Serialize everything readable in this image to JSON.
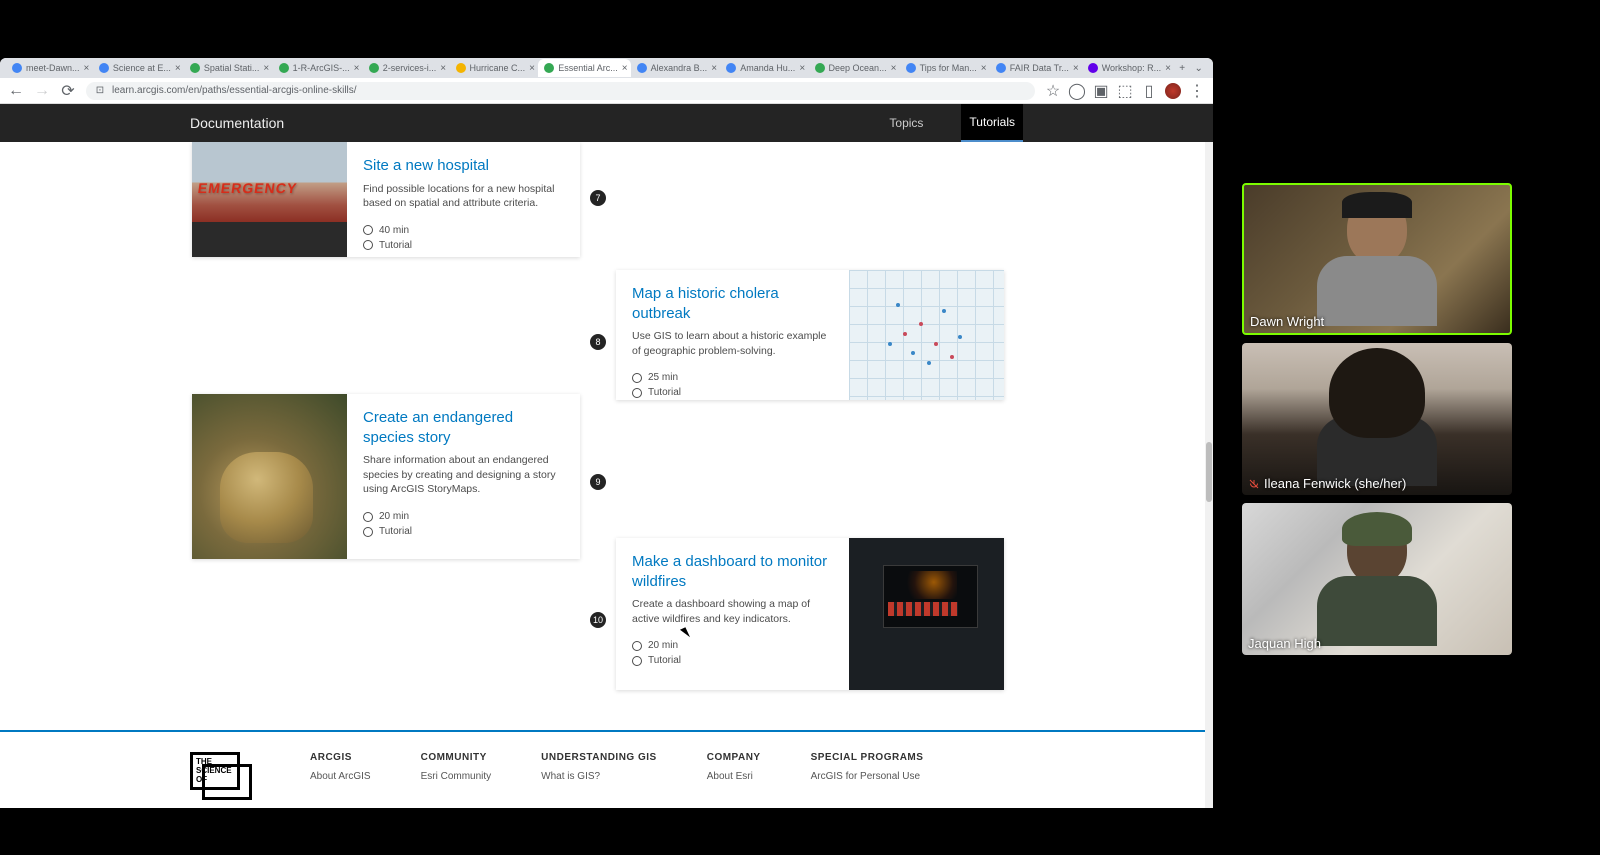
{
  "tabs": [
    {
      "label": "meet-Dawn...",
      "favicon": "blue"
    },
    {
      "label": "Science at E...",
      "favicon": "blue"
    },
    {
      "label": "Spatial Stati...",
      "favicon": "green"
    },
    {
      "label": "1-R-ArcGIS-...",
      "favicon": "green"
    },
    {
      "label": "2-services-i...",
      "favicon": "green"
    },
    {
      "label": "Hurricane C...",
      "favicon": "orange"
    },
    {
      "label": "Essential Arc...",
      "favicon": "green",
      "active": true
    },
    {
      "label": "Alexandra B...",
      "favicon": "blue"
    },
    {
      "label": "Amanda Hu...",
      "favicon": "blue"
    },
    {
      "label": "Deep Ocean...",
      "favicon": "green"
    },
    {
      "label": "Tips for Man...",
      "favicon": "blue"
    },
    {
      "label": "FAIR Data Tr...",
      "favicon": "blue"
    },
    {
      "label": "Workshop: R...",
      "favicon": "purple"
    }
  ],
  "url": "learn.arcgis.com/en/paths/essential-arcgis-online-skills/",
  "topnav": {
    "title": "Documentation",
    "links": [
      "Topics",
      "Tutorials"
    ],
    "active": "Tutorials"
  },
  "cards": {
    "c1": {
      "num": "7",
      "title": "Site a new hospital",
      "desc": "Find possible locations for a new hospital based on spatial and attribute criteria.",
      "time": "40 min",
      "type": "Tutorial"
    },
    "c2": {
      "num": "8",
      "title": "Map a historic cholera outbreak",
      "desc": "Use GIS to learn about a historic example of geographic problem-solving.",
      "time": "25 min",
      "type": "Tutorial"
    },
    "c3": {
      "num": "9",
      "title": "Create an endangered species story",
      "desc": "Share information about an endangered species by creating and designing a story using ArcGIS StoryMaps.",
      "time": "20 min",
      "type": "Tutorial"
    },
    "c4": {
      "num": "10",
      "title": "Make a dashboard to monitor wildfires",
      "desc": "Create a dashboard showing a map of active wildfires and key indicators.",
      "time": "20 min",
      "type": "Tutorial"
    }
  },
  "footer": {
    "logo_lines": [
      "THE",
      "SCIENCE",
      "OF"
    ],
    "cols": [
      {
        "hdr": "ARCGIS",
        "links": [
          "About ArcGIS"
        ]
      },
      {
        "hdr": "COMMUNITY",
        "links": [
          "Esri Community"
        ]
      },
      {
        "hdr": "UNDERSTANDING GIS",
        "links": [
          "What is GIS?"
        ]
      },
      {
        "hdr": "COMPANY",
        "links": [
          "About Esri"
        ]
      },
      {
        "hdr": "SPECIAL PROGRAMS",
        "links": [
          "ArcGIS for Personal Use"
        ]
      }
    ]
  },
  "participants": [
    {
      "name": "Dawn Wright",
      "muted": false,
      "active": true
    },
    {
      "name": "Ileana Fenwick (she/her)",
      "muted": true,
      "active": false
    },
    {
      "name": "Jaquan High",
      "muted": false,
      "active": false
    }
  ]
}
